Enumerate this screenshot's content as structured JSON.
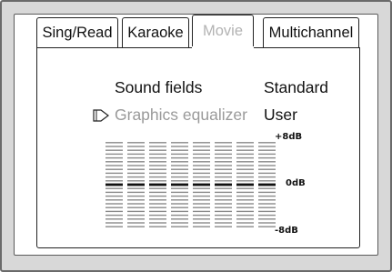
{
  "tabs": [
    {
      "label": "Sing/Read",
      "active": false
    },
    {
      "label": "Karaoke",
      "active": false
    },
    {
      "label": "Movie",
      "active": true
    },
    {
      "label": "Multichannel",
      "active": false
    }
  ],
  "settings": {
    "sound_fields": {
      "label": "Sound fields",
      "value": "Standard"
    },
    "graphics_equalizer": {
      "label": "Graphics equalizer",
      "value": "User"
    }
  },
  "equalizer": {
    "max_label": "+8dB",
    "mid_label": "0dB",
    "min_label": "-8dB",
    "band_count": 8,
    "levels_db": [
      0,
      0,
      0,
      0,
      0,
      0,
      0,
      0
    ]
  },
  "icons": {
    "cursor": "pointer-arrow-icon"
  },
  "colors": {
    "active_tab_text": "#b3b3b3",
    "disabled_text": "#9a9a9a",
    "frame": "#d8d8d8"
  }
}
